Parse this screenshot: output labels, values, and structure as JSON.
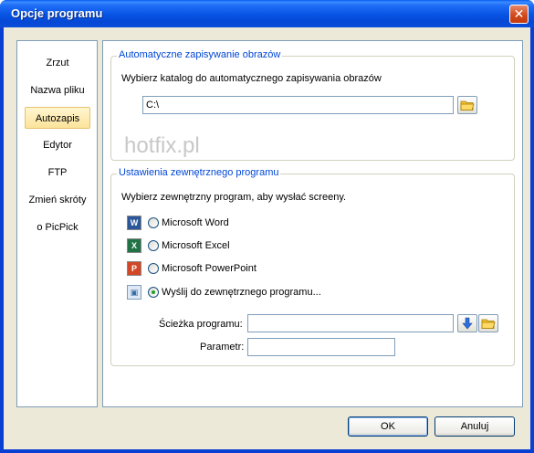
{
  "window": {
    "title": "Opcje programu",
    "close_glyph": "✕"
  },
  "sidebar": {
    "items": [
      {
        "label": "Zrzut",
        "active": false
      },
      {
        "label": "Nazwa pliku",
        "active": false
      },
      {
        "label": "Autozapis",
        "active": true
      },
      {
        "label": "Edytor",
        "active": false
      },
      {
        "label": "FTP",
        "active": false
      },
      {
        "label": "Zmień skróty",
        "active": false
      },
      {
        "label": "o PicPick",
        "active": false
      }
    ]
  },
  "autosave": {
    "group_title": "Automatyczne zapisywanie obrazów",
    "description": "Wybierz katalog do automatycznego zapisywania obrazów",
    "path_value": "C:\\",
    "browse_icon": "folder-icon"
  },
  "watermark": "hotfix.pl",
  "external": {
    "group_title": "Ustawienia zewnętrznego programu",
    "description": "Wybierz zewnętrzny program, aby wysłać screeny.",
    "options": [
      {
        "label": "Microsoft Word",
        "icon": "word-icon",
        "checked": false
      },
      {
        "label": "Microsoft Excel",
        "icon": "excel-icon",
        "checked": false
      },
      {
        "label": "Microsoft PowerPoint",
        "icon": "powerpoint-icon",
        "checked": false
      },
      {
        "label": "Wyślij do zewnętrznego programu...",
        "icon": "external-program-icon",
        "checked": true
      }
    ],
    "program_path_label": "Ścieżka programu:",
    "program_path_value": "",
    "parameter_label": "Parametr:",
    "parameter_value": ""
  },
  "footer": {
    "ok_label": "OK",
    "cancel_label": "Anuluj"
  },
  "colors": {
    "accent": "#0046d5",
    "titlebar": "#0753e3",
    "close": "#d24a1c"
  }
}
